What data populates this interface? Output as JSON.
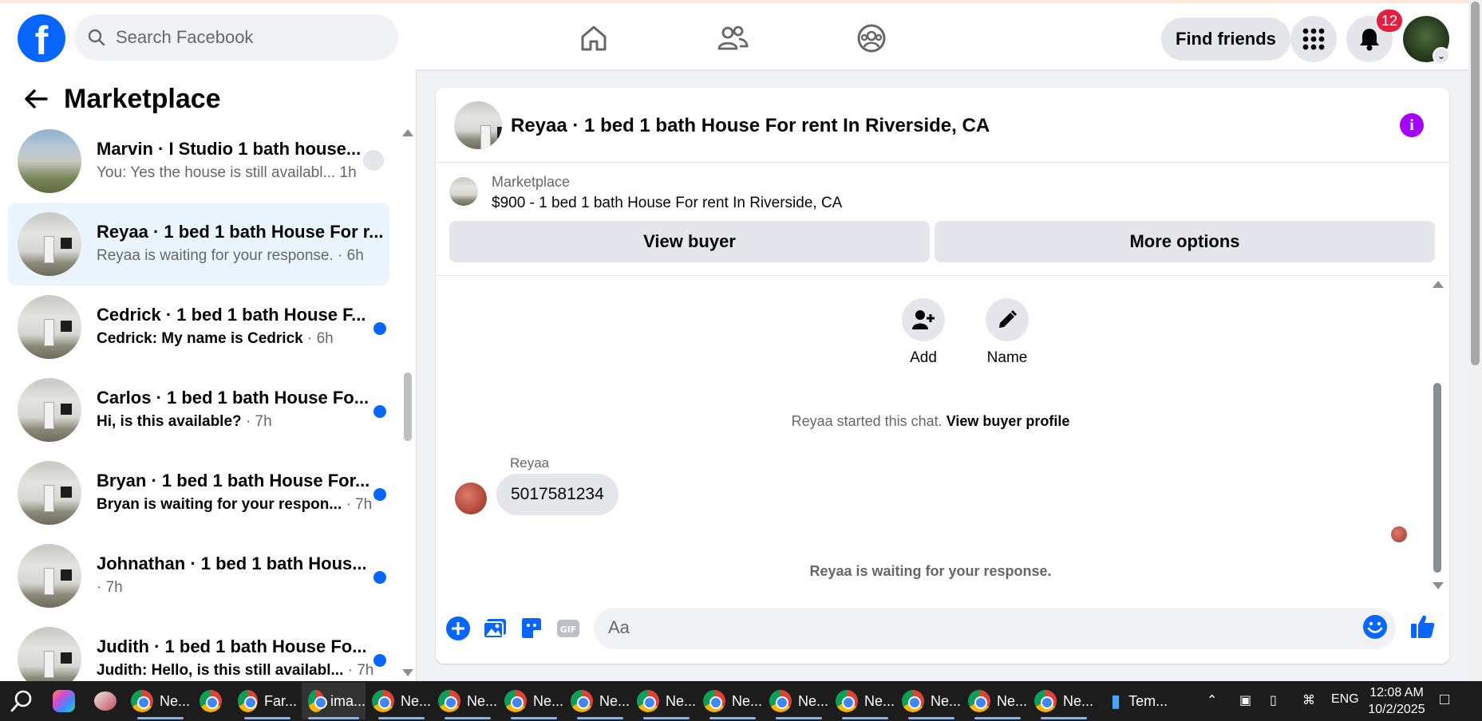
{
  "topbar": {
    "logo_letter": "f",
    "search_placeholder": "Search Facebook",
    "nav_icons": [
      "home-icon",
      "friends-icon",
      "groups-icon"
    ],
    "find_friends": "Find friends",
    "notification_count": "12"
  },
  "sidebar": {
    "title": "Marketplace",
    "conversations": [
      {
        "name": "Marvin · I Studio 1 bath house...",
        "preview": "You: Yes the house is still availabl...",
        "time": " 1h",
        "unread": false,
        "status": "seen"
      },
      {
        "name": "Reyaa · 1 bed 1 bath House For r...",
        "preview": "Reyaa is waiting for your response. ",
        "time": "· 6h",
        "unread": false,
        "status": "active"
      },
      {
        "name": "Cedrick · 1 bed 1 bath House F...",
        "preview": "Cedrick: My name is Cedrick ",
        "time": "· 6h",
        "unread": true,
        "status": "dot"
      },
      {
        "name": "Carlos · 1 bed 1 bath House Fo...",
        "preview": "Hi, is this available? ",
        "time": "· 7h",
        "unread": true,
        "status": "dot"
      },
      {
        "name": "Bryan · 1 bed 1 bath House For...",
        "preview": "Bryan is waiting for your respon... ",
        "time": "· 7h",
        "unread": true,
        "status": "dot"
      },
      {
        "name": "Johnathan · 1 bed 1 bath Hous...",
        "preview": " ",
        "time": "· 7h",
        "unread": true,
        "status": "dot"
      },
      {
        "name": "Judith · 1 bed 1 bath House Fo...",
        "preview": "Judith: Hello, is this still availabl... ",
        "time": "· 7h",
        "unread": true,
        "status": "dot"
      }
    ]
  },
  "chat": {
    "title": "Reyaa · 1 bed 1 bath House For rent In Riverside, CA",
    "listing_label": "Marketplace",
    "listing_desc": "$900 - 1 bed 1 bath House For rent In Riverside, CA",
    "view_buyer": "View buyer",
    "more_options": "More options",
    "add_label": "Add",
    "name_label": "Name",
    "started_text": "Reyaa started this chat. ",
    "view_profile": "View buyer profile",
    "sender": "Reyaa",
    "message": "5017581234",
    "waiting": "Reyaa is waiting for your response.",
    "input_placeholder": "Aa"
  },
  "taskbar": {
    "items": [
      "Ne...",
      "",
      "Far...",
      "ima...",
      "Ne...",
      "Ne...",
      "Ne...",
      "Ne...",
      "Ne...",
      "Ne...",
      "Ne...",
      "Ne...",
      "Ne...",
      "Ne...",
      "Ne..."
    ],
    "weather": "Tem...",
    "lang": "ENG",
    "time": "12:08 AM",
    "date": "10/2/2025"
  },
  "colors": {
    "brand": "#0866ff",
    "accent_info": "#a200ff",
    "badge": "#e41e3f"
  }
}
